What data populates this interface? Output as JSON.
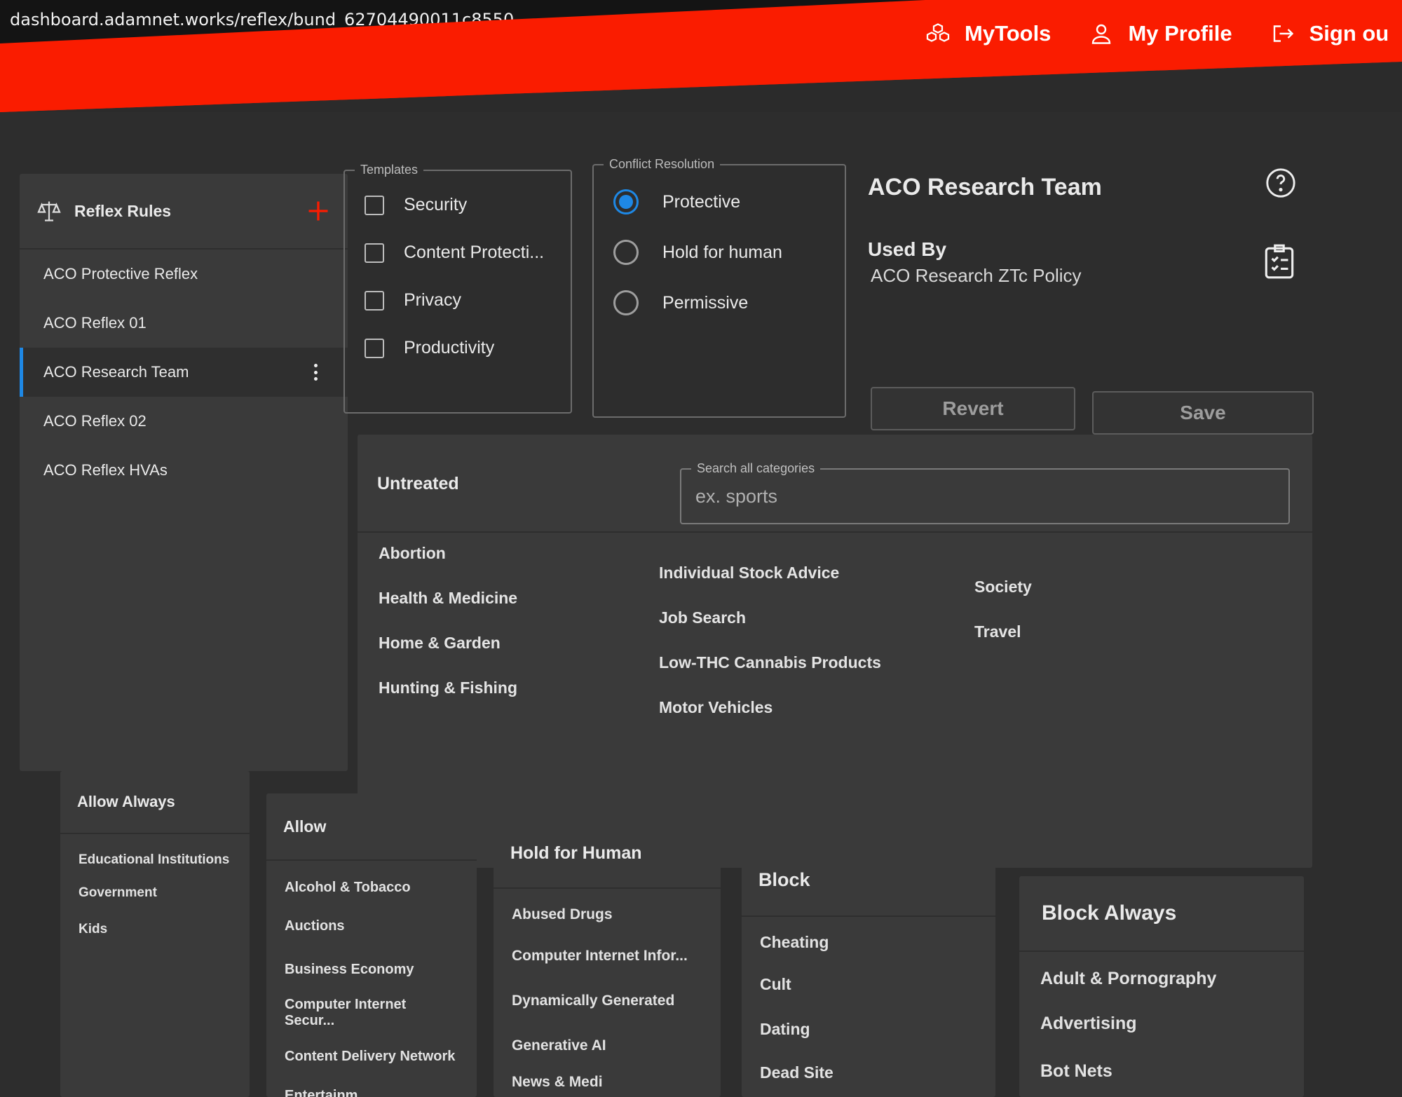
{
  "browser": {
    "url": "dashboard.adamnet.works/reflex/bund_62704490011c8550..."
  },
  "topnav": {
    "mytools": "MyTools",
    "profile": "My Profile",
    "signout": "Sign ou"
  },
  "rules": {
    "title": "Reflex Rules",
    "items": [
      {
        "label": "ACO Protective Reflex"
      },
      {
        "label": "ACO Reflex 01"
      },
      {
        "label": "ACO Research Team",
        "active": true
      },
      {
        "label": "ACO Reflex 02"
      },
      {
        "label": "ACO Reflex HVAs"
      }
    ]
  },
  "templates": {
    "legend": "Templates",
    "options": [
      "Security",
      "Content Protecti...",
      "Privacy",
      "Productivity"
    ]
  },
  "conflict": {
    "legend": "Conflict Resolution",
    "options": [
      "Protective",
      "Hold for human",
      "Permissive"
    ],
    "selected": "Protective"
  },
  "info": {
    "title": "ACO Research Team",
    "used_by_label": "Used By",
    "used_by_value": "ACO Research ZTc Policy",
    "revert": "Revert",
    "save": "Save"
  },
  "untreated": {
    "title": "Untreated",
    "search_legend": "Search all categories",
    "search_placeholder": "ex. sports",
    "col1": [
      "Abortion",
      "Health & Medicine",
      "Home & Garden",
      "Hunting & Fishing"
    ],
    "col2": [
      "Individual Stock Advice",
      "Job Search",
      "Low-THC Cannabis Products",
      "Motor Vehicles"
    ],
    "col3": [
      "Society",
      "Travel"
    ]
  },
  "columns": {
    "allow_always": {
      "title": "Allow Always",
      "items": [
        "Educational Institutions",
        "Government",
        "Kids"
      ]
    },
    "allow": {
      "title": "Allow",
      "items": [
        "Alcohol & Tobacco",
        "Auctions",
        "Business Economy",
        "Computer Internet Secur...",
        "Content Delivery Network",
        "Entertainm"
      ]
    },
    "hold": {
      "title": "Hold for Human",
      "items": [
        "Abused Drugs",
        "Computer Internet Infor...",
        "Dynamically Generated",
        "Generative AI",
        "News & Medi"
      ]
    },
    "block": {
      "title": "Block",
      "items": [
        "Cheating",
        "Cult",
        "Dating",
        "Dead Site"
      ]
    },
    "block_always": {
      "title": "Block Always",
      "items": [
        "Adult & Pornography",
        "Advertising",
        "Bot Nets"
      ]
    }
  },
  "colors": {
    "brand": "#fa1c00",
    "accent": "#1e88e5",
    "panel": "#3a3a3a",
    "background": "#2d2d2d"
  },
  "icons": [
    "boxes-icon",
    "user-icon",
    "signout-icon",
    "scale-icon",
    "plus-icon",
    "kebab-icon",
    "help-icon",
    "clipboard-icon"
  ]
}
